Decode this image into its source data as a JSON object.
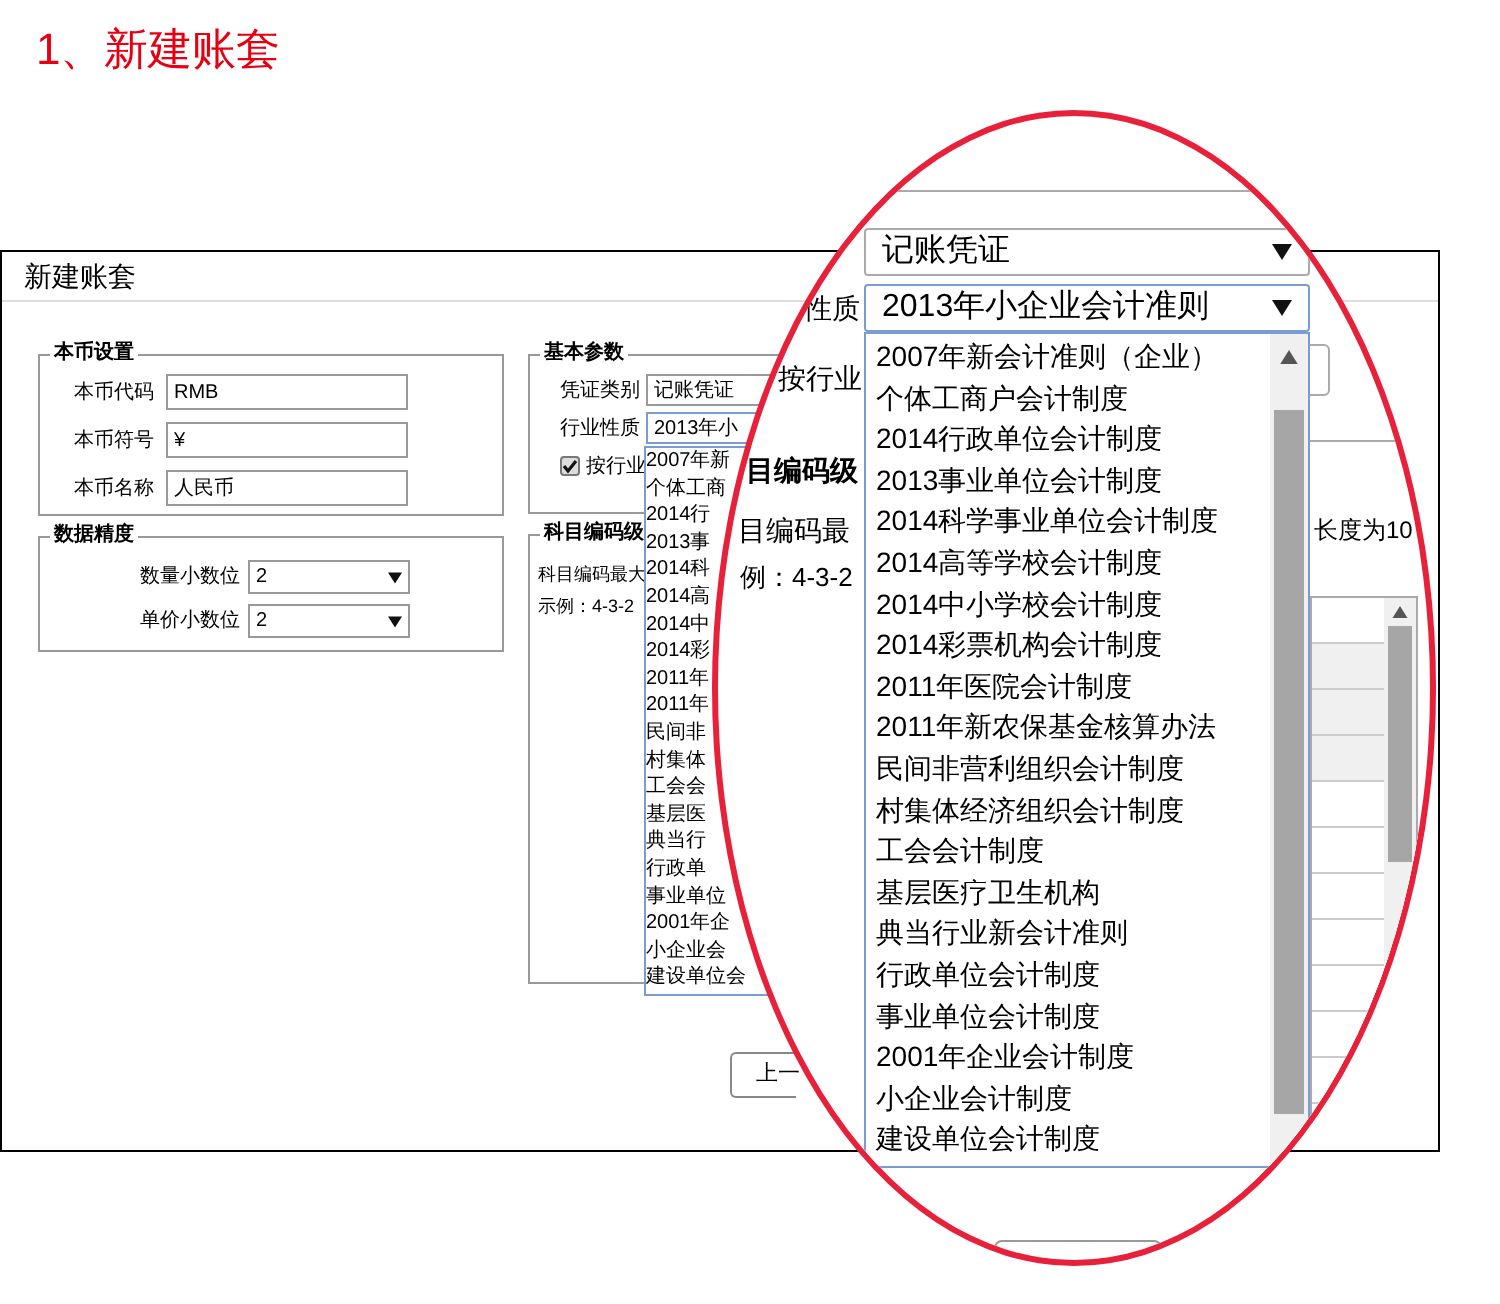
{
  "heading": "1、新建账套",
  "window": {
    "title": "新建账套",
    "currency": {
      "title": "本币设置",
      "fields": [
        {
          "label": "本币代码",
          "value": "RMB"
        },
        {
          "label": "本币符号",
          "value": "¥"
        },
        {
          "label": "本币名称",
          "value": "人民币"
        }
      ]
    },
    "precision": {
      "title": "数据精度",
      "fields": [
        {
          "label": "数量小数位",
          "value": "2"
        },
        {
          "label": "单价小数位",
          "value": "2"
        }
      ]
    },
    "basic": {
      "title": "基本参数",
      "voucher_type": {
        "label": "凭证类别",
        "value": "记账凭证"
      },
      "industry": {
        "label": "行业性质",
        "value": "2013年小"
      },
      "by_industry": {
        "label": "按行业",
        "checked": true
      },
      "options": [
        "2007年新",
        "个体工商",
        "2014行",
        "2013事",
        "2014科",
        "2014高",
        "2014中",
        "2014彩",
        "2011年",
        "2011年",
        "民间非",
        "村集体",
        "工会会",
        "基层医",
        "典当行",
        "行政单",
        "事业单位",
        "2001年企",
        "小企业会",
        "建设单位会"
      ]
    },
    "coding": {
      "title": "科目编码级",
      "lines": [
        "科目编码最大",
        "示例：4-3-2"
      ]
    },
    "back_button": "上一"
  },
  "magnifier": {
    "voucher_value": "记账凭证",
    "industry_label": "性质",
    "industry_value": "2013年小企业会计准则",
    "by_industry_label": "按行业",
    "coding_title": "目编码级",
    "coding_line": "目编码最",
    "length_text": "长度为10",
    "example": "例：4-3-2",
    "options": [
      "2007年新会计准则（企业）",
      "个体工商户会计制度",
      "2014行政单位会计制度",
      "2013事业单位会计制度",
      "2014科学事业单位会计制度",
      "2014高等学校会计制度",
      "2014中小学校会计制度",
      "2014彩票机构会计制度",
      "2011年医院会计制度",
      "2011年新农保基金核算办法",
      "民间非营利组织会计制度",
      "村集体经济组织会计制度",
      "工会会计制度",
      "基层医疗卫生机构",
      "典当行业新会计准则",
      "行政单位会计制度",
      "事业单位会计制度",
      "2001年企业会计制度",
      "小企业会计制度",
      "建设单位会计制度"
    ]
  }
}
